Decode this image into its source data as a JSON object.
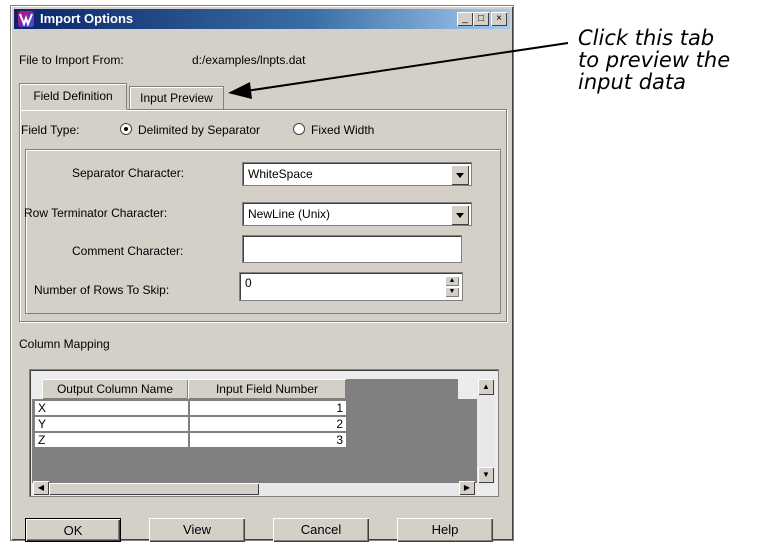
{
  "window": {
    "title": "Import Options",
    "controls": {
      "minimize": "_",
      "maximize": "□",
      "close": "×"
    }
  },
  "file": {
    "label": "File to Import From:",
    "value": "d:/examples/lnpts.dat"
  },
  "tabs": [
    {
      "label": "Field Definition",
      "active": true
    },
    {
      "label": "Input Preview",
      "active": false
    }
  ],
  "field_type": {
    "label": "Field Type:",
    "options": [
      {
        "label": "Delimited by Separator",
        "selected": true
      },
      {
        "label": "Fixed Width",
        "selected": false
      }
    ]
  },
  "form": {
    "separator": {
      "label": "Separator Character:",
      "value": "WhiteSpace"
    },
    "row_terminator": {
      "label": "Row Terminator Character:",
      "value": "NewLine (Unix)"
    },
    "comment": {
      "label": "Comment Character:",
      "value": ""
    },
    "rows_to_skip": {
      "label": "Number of Rows To Skip:",
      "value": "0"
    }
  },
  "column_mapping": {
    "label": "Column Mapping",
    "headers": [
      "Output Column Name",
      "Input Field Number"
    ],
    "rows": [
      {
        "name": "X",
        "field": "1"
      },
      {
        "name": "Y",
        "field": "2"
      },
      {
        "name": "Z",
        "field": "3"
      }
    ]
  },
  "buttons": {
    "ok": "OK",
    "view": "View",
    "cancel": "Cancel",
    "help": "Help"
  },
  "annotation": {
    "line1": "Click this tab",
    "line2": "to preview the",
    "line3": "input data"
  },
  "colors": {
    "titlebar": "#0a246a",
    "dialog": "#d4d0c8"
  }
}
